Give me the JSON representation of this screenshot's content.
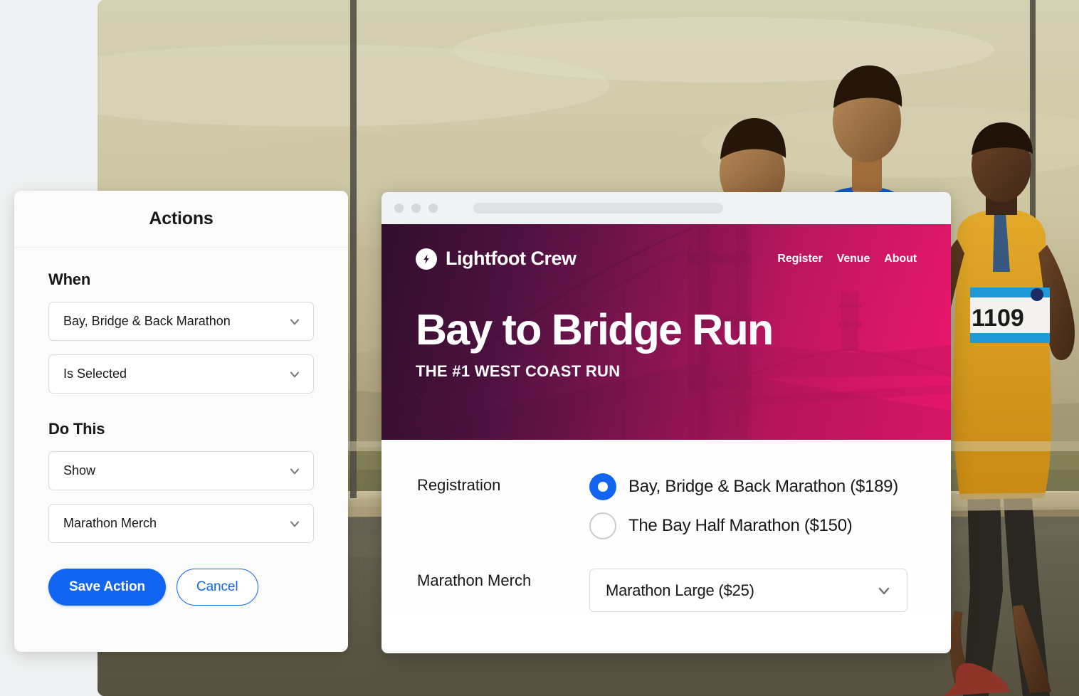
{
  "background_photo": {
    "description": "Three male marathon runners on a bridge at golden hour",
    "bib_number": "1109"
  },
  "actions_panel": {
    "title": "Actions",
    "when_label": "When",
    "do_this_label": "Do This",
    "when_selects": [
      {
        "value": "Bay, Bridge & Back Marathon",
        "icon": "chevron-down-icon"
      },
      {
        "value": "Is Selected",
        "icon": "chevron-down-icon"
      }
    ],
    "do_this_selects": [
      {
        "value": "Show",
        "icon": "chevron-down-icon"
      },
      {
        "value": "Marathon Merch",
        "icon": "chevron-down-icon"
      }
    ],
    "save_label": "Save Action",
    "cancel_label": "Cancel",
    "accent_color": "#1165f0"
  },
  "browser": {
    "dots": [
      "dot-red",
      "dot-yellow",
      "dot-green"
    ],
    "urlbar_placeholder": ""
  },
  "site": {
    "brand": {
      "name": "Lightfoot Crew",
      "mark_icon": "lightning-bolt-icon"
    },
    "nav": [
      {
        "label": "Register"
      },
      {
        "label": "Venue"
      },
      {
        "label": "About"
      }
    ],
    "hero": {
      "title": "Bay to Bridge Run",
      "subtitle": "THE #1 WEST COAST RUN",
      "gradient_from": "#300e2c",
      "gradient_to": "#e7166a"
    },
    "form": {
      "registration": {
        "label": "Registration",
        "options": [
          {
            "label": "Bay, Bridge & Back Marathon ($189)",
            "checked": true
          },
          {
            "label": "The Bay Half Marathon ($150)",
            "checked": false
          }
        ]
      },
      "merch": {
        "label": "Marathon Merch",
        "value": "Marathon Large ($25)",
        "icon": "chevron-down-icon"
      }
    }
  }
}
